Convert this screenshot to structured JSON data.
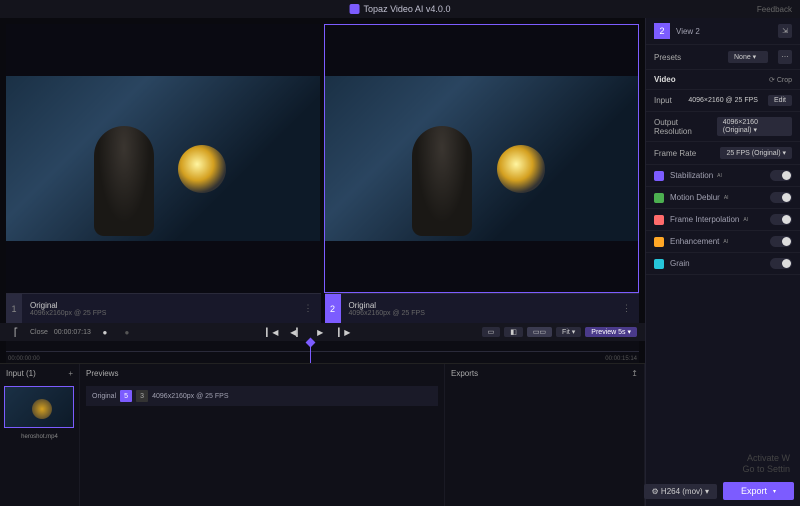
{
  "titlebar": {
    "app_title": "Topaz Video AI  v4.0.0",
    "feedback": "Feedback"
  },
  "panes": [
    {
      "num": "1",
      "title": "Original",
      "sub": "4096x2160px @ 25 FPS"
    },
    {
      "num": "2",
      "title": "Original",
      "sub": "4096x2160px @ 25 FPS"
    }
  ],
  "transport": {
    "close": "Close",
    "timecode": "00:00:07:13",
    "fit": "Fit",
    "preview": "Preview 5s",
    "t_start": "00:00:00:00",
    "t_end": "00:00:15:14"
  },
  "bottom": {
    "input_title": "Input (1)",
    "thumb_name": "heroshot.mp4",
    "previews_title": "Previews",
    "preview_row": {
      "name": "Original",
      "badge": "5",
      "badge2": "3",
      "res": "4096x2160px @ 25 FPS"
    },
    "exports_title": "Exports"
  },
  "sidebar": {
    "view_num": "2",
    "view_label": "View 2",
    "presets_label": "Presets",
    "presets_value": "None",
    "video_label": "Video",
    "crop_label": "Crop",
    "input_label": "Input",
    "input_value": "4096×2160 @ 25 FPS",
    "edit_label": "Edit",
    "outres_label": "Output Resolution",
    "outres_value": "4096×2160 (Original)",
    "fps_label": "Frame Rate",
    "fps_value": "25 FPS (Original)",
    "effects": [
      {
        "label": "Stabilization",
        "cls": "st"
      },
      {
        "label": "Motion Deblur",
        "cls": "md"
      },
      {
        "label": "Frame Interpolation",
        "cls": "fi"
      },
      {
        "label": "Enhancement",
        "cls": "en"
      },
      {
        "label": "Grain",
        "cls": "gr"
      }
    ]
  },
  "footer": {
    "codec": "H264 (mov)",
    "export": "Export"
  },
  "watermark": {
    "l1": "Activate W",
    "l2": "Go to Settin"
  }
}
